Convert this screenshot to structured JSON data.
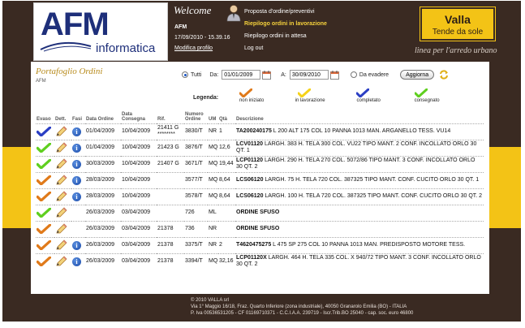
{
  "header": {
    "logo_top": "AFM",
    "logo_bottom": "informatica",
    "welcome": "Welcome",
    "user": "AFM",
    "timestamp": "17/09/2010 - 15.39.16",
    "edit_profile": "Modifica profilo",
    "menu": [
      {
        "label": "Proposta d'ordine/preventivi",
        "active": false
      },
      {
        "label": "Riepilogo ordini in lavorazione",
        "active": true
      },
      {
        "label": "Riepilogo ordini in attesa",
        "active": false
      },
      {
        "label": "Log out",
        "active": false
      }
    ],
    "brand_name": "Valla",
    "brand_tag": "Tende da sole",
    "brand_slogan": "linea per l'arredo urbano"
  },
  "panel": {
    "title": "Portafoglio Ordini",
    "subtitle": "AFM"
  },
  "filters": {
    "all_label": "Tutti",
    "from_label": "Da:",
    "from_value": "01/01/2009",
    "to_label": "A:",
    "to_value": "30/09/2010",
    "pending_label": "Da evadere",
    "update_button": "Aggiorna",
    "selected": "Tutti"
  },
  "legend": {
    "title": "Legenda:",
    "items": [
      {
        "label": "non iniziato",
        "color": "#e07a1a"
      },
      {
        "label": "in lavorazione",
        "color": "#f5d21a"
      },
      {
        "label": "completato",
        "color": "#2b3fc4"
      },
      {
        "label": "consegnato",
        "color": "#5fcf1f"
      }
    ]
  },
  "table": {
    "columns": [
      "Evaso",
      "Dett.",
      "Fasi",
      "Data Ordine",
      "Data Consegna",
      "Rif.",
      "Numero Ordine",
      "UM",
      "Qtà",
      "Descrizione"
    ],
    "rows": [
      {
        "status": "completato",
        "info": true,
        "data_ordine": "01/04/2009",
        "data_consegna": "10/04/2009",
        "rif": "21411 G ********",
        "numero": "3830/T",
        "um": "NR",
        "qta": "1",
        "code": "TA200240175",
        "desc": " L 200 ALT 175 COL 10 PANNA 1013 MAN. ARGANELLO TESS. VU14"
      },
      {
        "status": "consegnato",
        "info": true,
        "data_ordine": "01/04/2009",
        "data_consegna": "10/04/2009",
        "rif": "21423 G",
        "numero": "3876/T",
        "um": "MQ",
        "qta": "12,6",
        "code": "LCV01120",
        "desc": " LARGH. 383 H. TELA 300 COL. VU22 TIPO MANT. 2 CONF. INCOLLATO ORLO 30 QT. 1"
      },
      {
        "status": "consegnato",
        "info": true,
        "data_ordine": "30/03/2009",
        "data_consegna": "10/04/2009",
        "rif": "21407 G",
        "numero": "3671/T",
        "um": "MQ",
        "qta": "19,44",
        "code": "LCP01120",
        "desc": " LARGH. 290 H. TELA 270 COL. 5072/86 TIPO MANT. 3 CONF. INCOLLATO ORLO 30 QT. 2"
      },
      {
        "status": "non iniziato",
        "info": true,
        "data_ordine": "28/03/2009",
        "data_consegna": "10/04/2009",
        "rif": "",
        "numero": "3577/T",
        "um": "MQ",
        "qta": "8,64",
        "code": "LCS06120",
        "desc": " LARGH. 75 H. TELA 720 COL. 387325 TIPO MANT. CONF. CUCITO ORLO 30 QT. 1"
      },
      {
        "status": "non iniziato",
        "info": true,
        "data_ordine": "28/03/2009",
        "data_consegna": "10/04/2009",
        "rif": "",
        "numero": "3578/T",
        "um": "MQ",
        "qta": "8,64",
        "code": "LCS06120",
        "desc": " LARGH. 100 H. TELA 720 COL. 387325 TIPO MANT. CONF. CUCITO ORLO 30 QT. 2"
      },
      {
        "status": "consegnato",
        "info": false,
        "data_ordine": "26/03/2009",
        "data_consegna": "03/04/2009",
        "rif": "",
        "numero": "726",
        "um": "ML",
        "qta": "",
        "code": "ORDINE SFUSO",
        "desc": ""
      },
      {
        "status": "non iniziato",
        "info": false,
        "data_ordine": "26/03/2009",
        "data_consegna": "03/04/2009",
        "rif": "21378",
        "numero": "736",
        "um": "NR",
        "qta": "",
        "code": "ORDINE SFUSO",
        "desc": ""
      },
      {
        "status": "non iniziato",
        "info": true,
        "data_ordine": "26/03/2009",
        "data_consegna": "03/04/2009",
        "rif": "21378",
        "numero": "3375/T",
        "um": "NR",
        "qta": "2",
        "code": "T4620475275",
        "desc": " L 475 SP 275 COL 10 PANNA 1013 MAN. PREDISPOSTO MOTORE TESS."
      },
      {
        "status": "non iniziato",
        "info": true,
        "data_ordine": "26/03/2009",
        "data_consegna": "03/04/2009",
        "rif": "21378",
        "numero": "3394/T",
        "um": "MQ",
        "qta": "32,16",
        "code": "LCP01120X",
        "desc": " LARGH. 464 H. TELA 335 COL. X 940/72 TIPO MANT. 3 CONF. INCOLLATO ORLO 30 QT. 2"
      }
    ]
  },
  "footer": {
    "lines": [
      "© 2010 VALLA srl",
      "Via 1° Maggio 16/18, Fraz. Quarto Inferiore (zona industriale), 40050 Granarolo Emilia (BO) - ITALIA",
      "P. Iva 00536531205 - CF 01169710371 - C.C.I.A.A. 239719 - Iscr.Trib.BO 25040 - cap. soc. euro 46800"
    ]
  }
}
